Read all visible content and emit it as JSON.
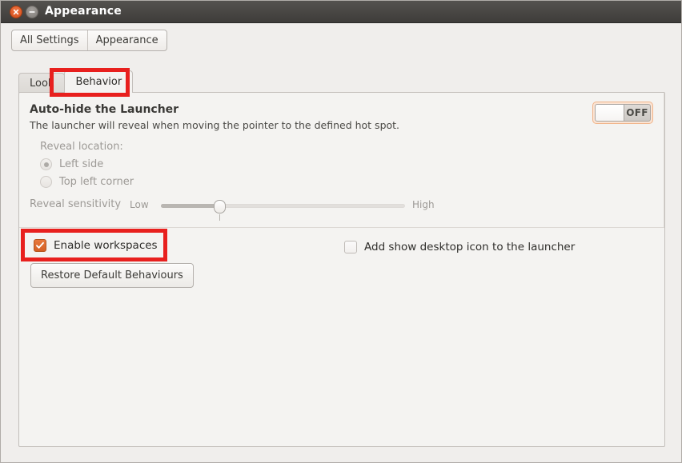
{
  "window": {
    "title": "Appearance",
    "close_icon": "close-x-icon",
    "minimize_icon": "minimize-dash-icon"
  },
  "navbar": {
    "all_settings_label": "All Settings",
    "appearance_label": "Appearance"
  },
  "tabs": [
    {
      "label": "Look",
      "active": false
    },
    {
      "label": "Behavior",
      "active": true
    }
  ],
  "autohide": {
    "title": "Auto-hide the Launcher",
    "description": "The launcher will reveal when moving the pointer to the defined hot spot.",
    "toggle_state": "OFF"
  },
  "reveal": {
    "location_label": "Reveal location:",
    "options": [
      {
        "label": "Left side",
        "selected": true
      },
      {
        "label": "Top left corner",
        "selected": false
      }
    ],
    "sensitivity_label": "Reveal sensitivity",
    "low_label": "Low",
    "high_label": "High",
    "slider_value_percent": 24
  },
  "options": {
    "enable_workspaces": {
      "label": "Enable workspaces",
      "checked": true
    },
    "show_desktop_icon": {
      "label": "Add show desktop icon to the launcher",
      "checked": false
    }
  },
  "restore": {
    "label": "Restore Default Behaviours"
  },
  "colors": {
    "accent_orange": "#d45f24",
    "annotation_red": "#e8201e",
    "titlebar_dark": "#4a4845",
    "panel_bg": "#f4f3f1",
    "window_bg": "#f0eeec"
  }
}
